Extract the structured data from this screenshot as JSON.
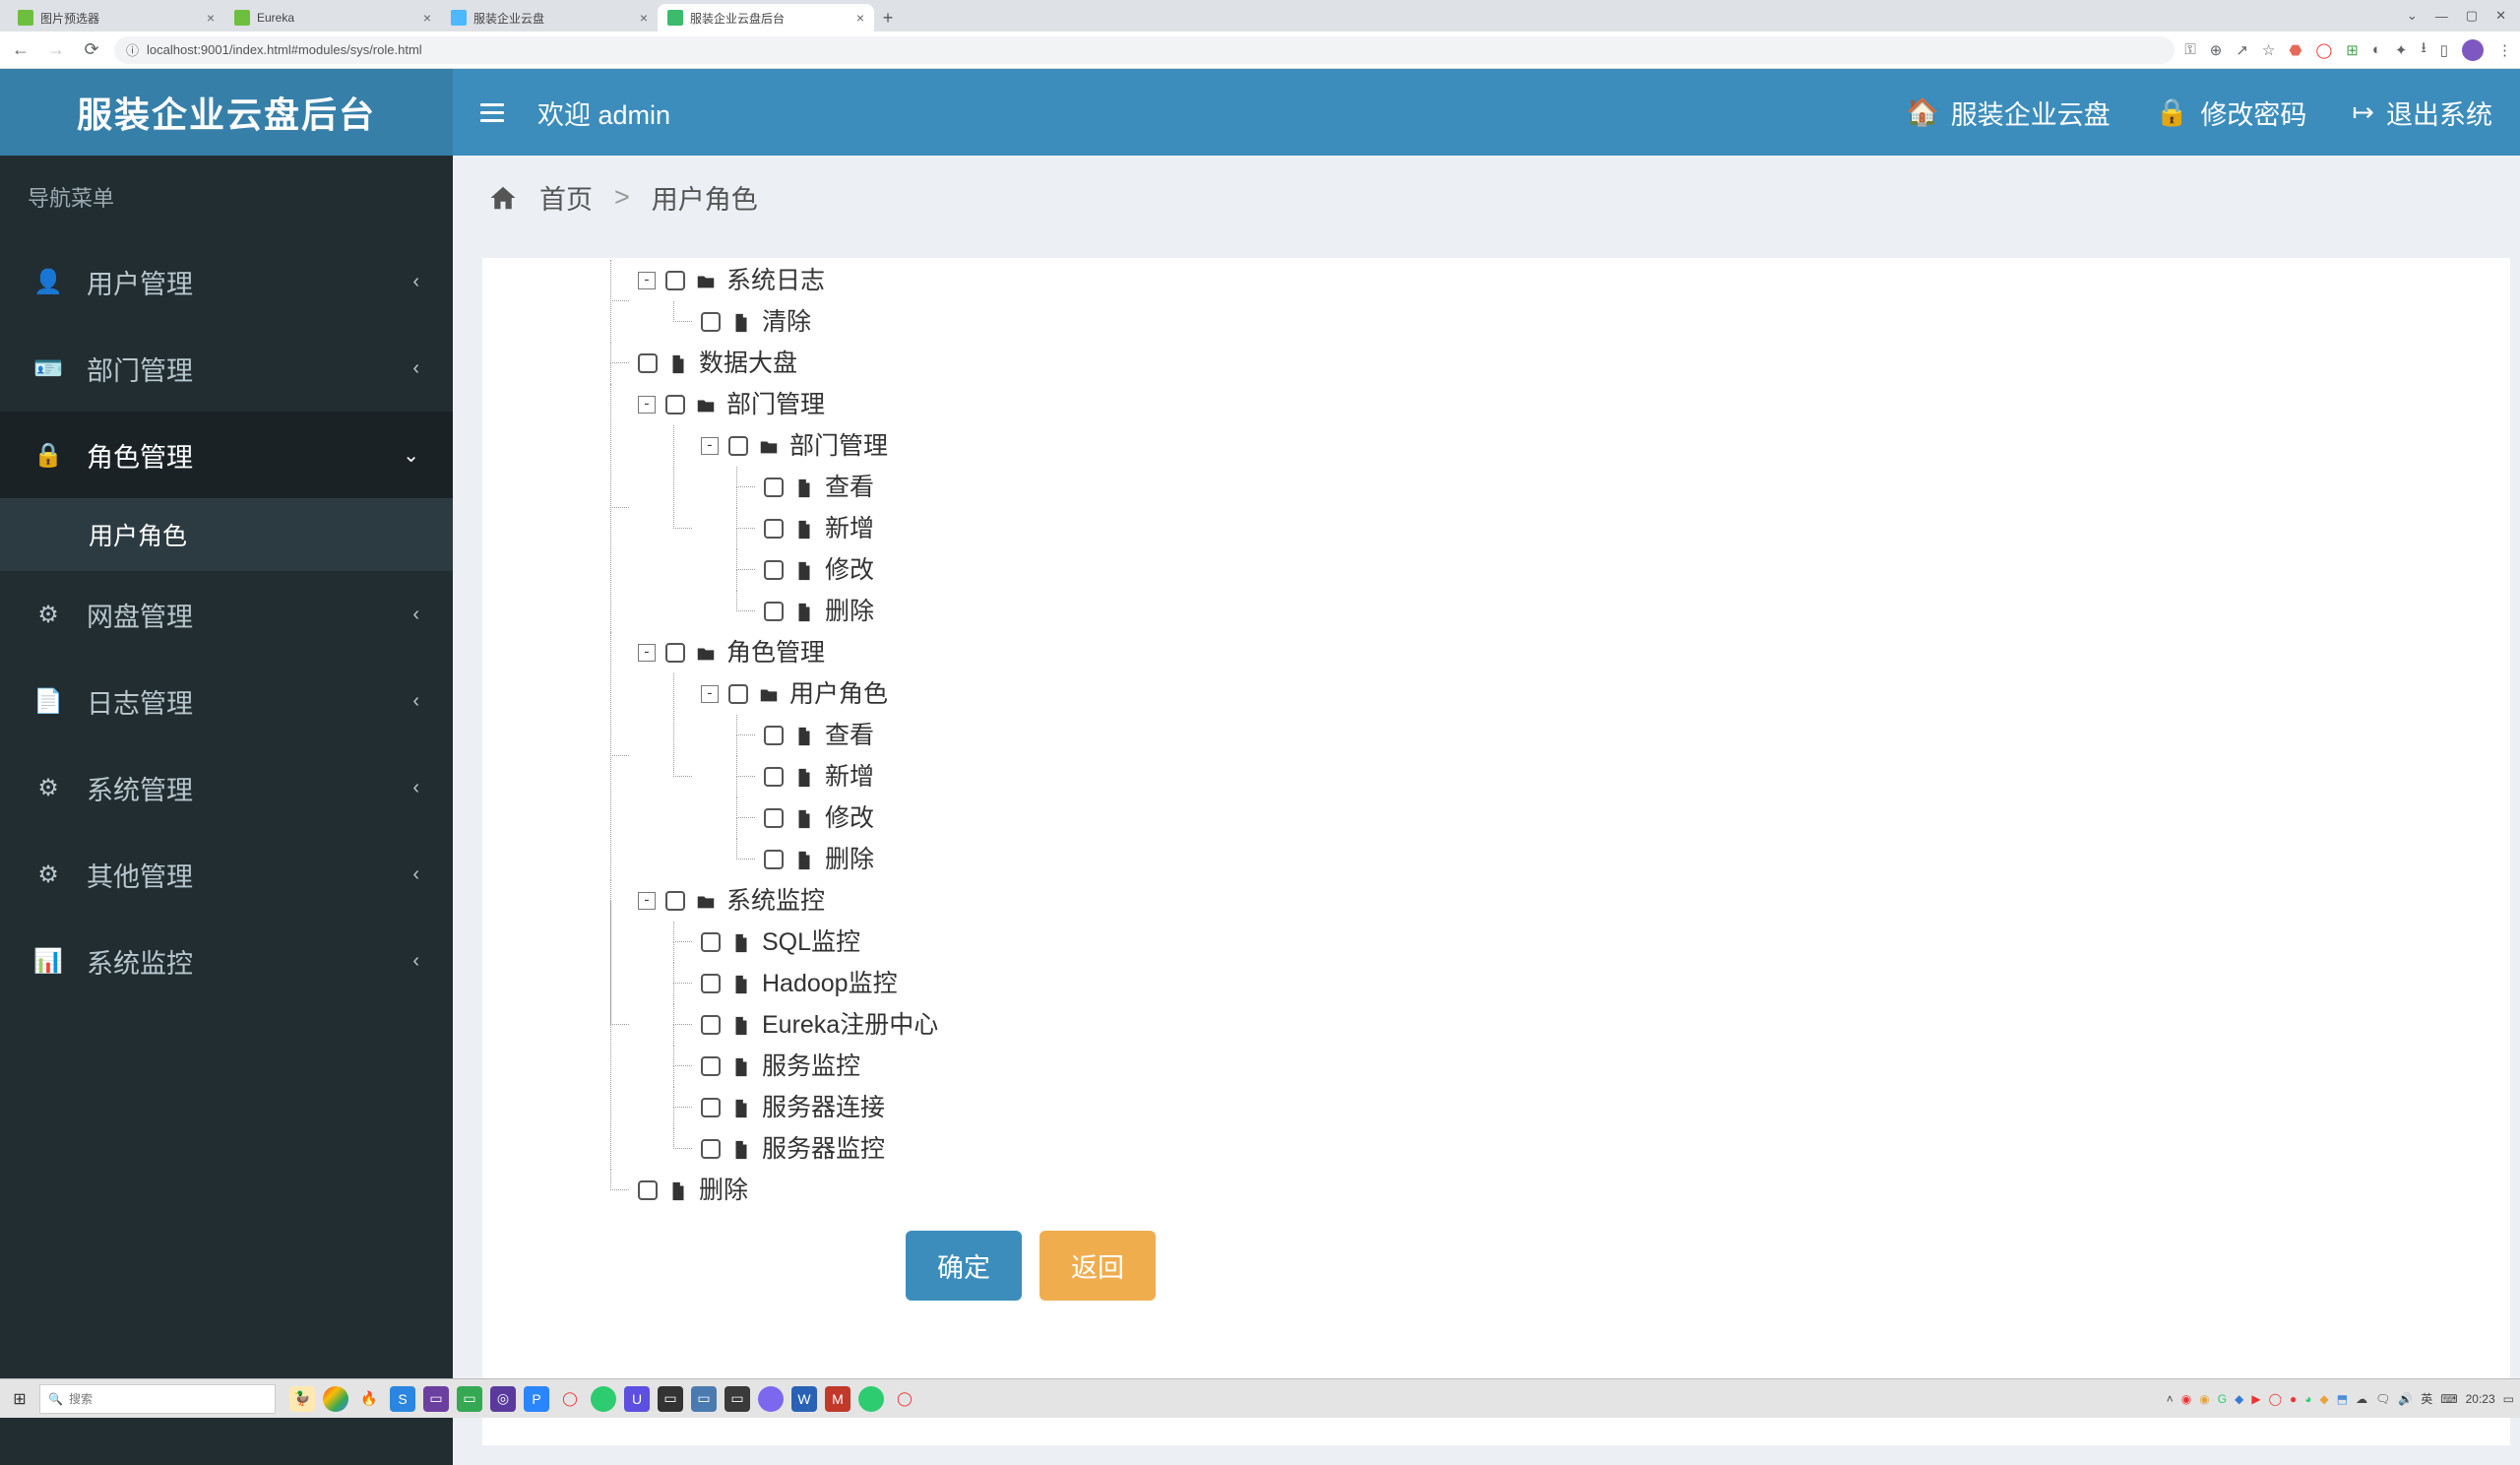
{
  "browser": {
    "tabs": [
      {
        "title": "图片预选器",
        "favicon": "#6fbf3f"
      },
      {
        "title": "Eureka",
        "favicon": "#6fbf3f"
      },
      {
        "title": "服装企业云盘",
        "favicon": "#4db8ff"
      },
      {
        "title": "服装企业云盘后台",
        "favicon": "#3cbb6c"
      }
    ],
    "active_tab": 3,
    "url": "localhost:9001/index.html#modules/sys/role.html"
  },
  "app": {
    "logo": "服装企业云盘后台",
    "welcome": "欢迎 admin",
    "header_links": {
      "home": "服装企业云盘",
      "pwd": "修改密码",
      "logout": "退出系统"
    }
  },
  "sidebar": {
    "title": "导航菜单",
    "items": [
      {
        "icon": "user",
        "label": "用户管理"
      },
      {
        "icon": "id",
        "label": "部门管理"
      },
      {
        "icon": "lock",
        "label": "角色管理",
        "active": true,
        "sub": "用户角色"
      },
      {
        "icon": "gear",
        "label": "网盘管理"
      },
      {
        "icon": "doc",
        "label": "日志管理"
      },
      {
        "icon": "gear",
        "label": "系统管理"
      },
      {
        "icon": "gear",
        "label": "其他管理"
      },
      {
        "icon": "chart",
        "label": "系统监控"
      }
    ]
  },
  "breadcrumb": {
    "home": "首页",
    "current": "用户角色"
  },
  "tree": [
    {
      "type": "folder-open",
      "label": "系统日志",
      "expander": "-",
      "depth": 1,
      "partial_top": true,
      "children": [
        {
          "type": "file",
          "label": "清除",
          "depth": 2
        }
      ]
    },
    {
      "type": "file",
      "label": "数据大盘",
      "depth": 1
    },
    {
      "type": "folder-open",
      "label": "部门管理",
      "expander": "-",
      "depth": 0,
      "children": [
        {
          "type": "folder-open",
          "label": "部门管理",
          "expander": "-",
          "depth": 1,
          "children": [
            {
              "type": "file",
              "label": "查看",
              "depth": 2
            },
            {
              "type": "file",
              "label": "新增",
              "depth": 2
            },
            {
              "type": "file",
              "label": "修改",
              "depth": 2
            },
            {
              "type": "file",
              "label": "删除",
              "depth": 2
            }
          ]
        }
      ]
    },
    {
      "type": "folder-open",
      "label": "角色管理",
      "expander": "-",
      "depth": 0,
      "children": [
        {
          "type": "folder-open",
          "label": "用户角色",
          "expander": "-",
          "depth": 1,
          "children": [
            {
              "type": "file",
              "label": "查看",
              "depth": 2
            },
            {
              "type": "file",
              "label": "新增",
              "depth": 2
            },
            {
              "type": "file",
              "label": "修改",
              "depth": 2
            },
            {
              "type": "file",
              "label": "删除",
              "depth": 2
            }
          ]
        }
      ]
    },
    {
      "type": "folder-open",
      "label": "系统监控",
      "expander": "-",
      "depth": 0,
      "children": [
        {
          "type": "file",
          "label": "SQL监控",
          "depth": 1
        },
        {
          "type": "file",
          "label": "Hadoop监控",
          "depth": 1
        },
        {
          "type": "file",
          "label": "Eureka注册中心",
          "depth": 1
        },
        {
          "type": "file",
          "label": "服务监控",
          "depth": 1
        },
        {
          "type": "file",
          "label": "服务器连接",
          "depth": 1
        },
        {
          "type": "file",
          "label": "服务器监控",
          "depth": 1
        }
      ]
    },
    {
      "type": "file",
      "label": "删除",
      "depth": 0
    }
  ],
  "buttons": {
    "ok": "确定",
    "back": "返回"
  },
  "taskbar": {
    "search_placeholder": "搜索",
    "time": "20:23",
    "ime": "英"
  }
}
